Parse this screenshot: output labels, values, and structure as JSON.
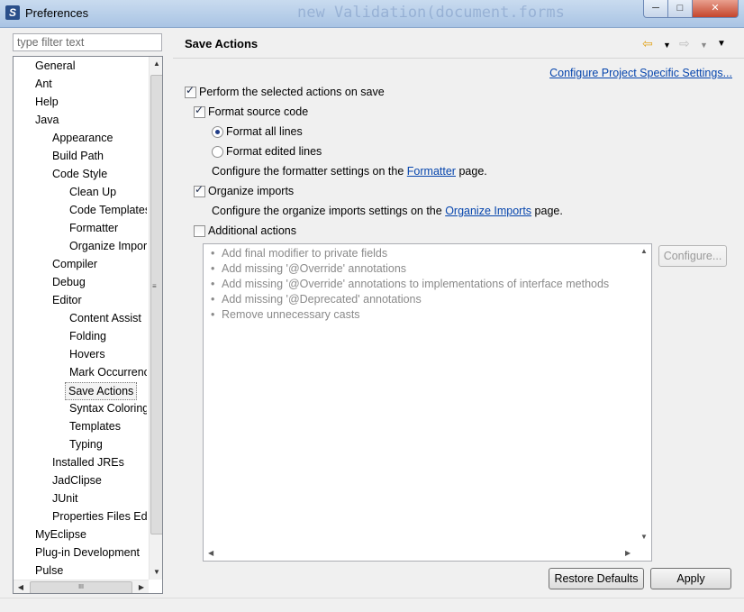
{
  "window": {
    "title": "Preferences",
    "background_code": "new Validation(document.forms"
  },
  "filter": {
    "placeholder": "type filter text",
    "value": ""
  },
  "tree": {
    "items": [
      {
        "label": "General",
        "level": 0
      },
      {
        "label": "Ant",
        "level": 0
      },
      {
        "label": "Help",
        "level": 0
      },
      {
        "label": "Java",
        "level": 0
      },
      {
        "label": "Appearance",
        "level": 1
      },
      {
        "label": "Build Path",
        "level": 1
      },
      {
        "label": "Code Style",
        "level": 1
      },
      {
        "label": "Clean Up",
        "level": 2
      },
      {
        "label": "Code Templates",
        "level": 2
      },
      {
        "label": "Formatter",
        "level": 2
      },
      {
        "label": "Organize Imports",
        "level": 2
      },
      {
        "label": "Compiler",
        "level": 1
      },
      {
        "label": "Debug",
        "level": 1
      },
      {
        "label": "Editor",
        "level": 1
      },
      {
        "label": "Content Assist",
        "level": 2
      },
      {
        "label": "Folding",
        "level": 2
      },
      {
        "label": "Hovers",
        "level": 2
      },
      {
        "label": "Mark Occurrences",
        "level": 2
      },
      {
        "label": "Save Actions",
        "level": 2,
        "selected": true
      },
      {
        "label": "Syntax Coloring",
        "level": 2
      },
      {
        "label": "Templates",
        "level": 2
      },
      {
        "label": "Typing",
        "level": 2
      },
      {
        "label": "Installed JREs",
        "level": 1
      },
      {
        "label": "JadClipse",
        "level": 1
      },
      {
        "label": "JUnit",
        "level": 1
      },
      {
        "label": "Properties Files Editor",
        "level": 1
      },
      {
        "label": "MyEclipse",
        "level": 0
      },
      {
        "label": "Plug-in Development",
        "level": 0
      },
      {
        "label": "Pulse",
        "level": 0
      }
    ]
  },
  "page": {
    "title": "Save Actions",
    "configure_project_link": "Configure Project Specific Settings...",
    "perform_on_save": {
      "label": "Perform the selected actions on save",
      "checked": true
    },
    "format_source": {
      "label": "Format source code",
      "checked": true
    },
    "format_all": {
      "label": "Format all lines",
      "checked": true
    },
    "format_edited": {
      "label": "Format edited lines",
      "checked": false
    },
    "formatter_text": {
      "before": "Configure the formatter settings on the ",
      "link": "Formatter",
      "after": " page."
    },
    "organize_imports": {
      "label": "Organize imports",
      "checked": true
    },
    "organize_text": {
      "before": "Configure the organize imports settings on the ",
      "link": "Organize Imports",
      "after": " page."
    },
    "additional_actions": {
      "label": "Additional actions",
      "checked": false
    },
    "actions_list": [
      "Add final modifier to private fields",
      "Add missing '@Override' annotations",
      "Add missing '@Override' annotations to implementations of interface methods",
      "Add missing '@Deprecated' annotations",
      "Remove unnecessary casts"
    ],
    "configure_button": "Configure...",
    "restore_defaults_button": "Restore Defaults",
    "apply_button": "Apply"
  },
  "colors": {
    "link": "#0645ad",
    "title_bar": "#b8cfea",
    "close_button": "#c4452c"
  },
  "icons": {
    "app": "eclipse-icon",
    "back": "back-arrow-icon",
    "forward": "forward-arrow-icon",
    "menu": "view-menu-icon"
  }
}
